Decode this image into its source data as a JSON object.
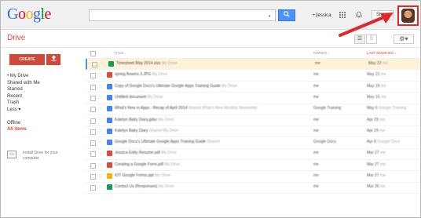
{
  "header": {
    "logo": [
      "G",
      "o",
      "o",
      "g",
      "l",
      "e"
    ],
    "search_placeholder": "",
    "search_dropdown": "▾",
    "search_icon": "search-icon",
    "user_name": "+Jessica",
    "share_label": "Share"
  },
  "subbar": {
    "title": "Drive"
  },
  "sidebar": {
    "create_label": "CREATE",
    "items": [
      "• My Drive",
      "Shared with Me",
      "Starred",
      "Recent",
      "Trash",
      "Less ▾",
      "",
      "Offline",
      "All items"
    ],
    "install_text": "Install Drive for your computer"
  },
  "list": {
    "headers": {
      "title": "TITLE",
      "owner": "OWNER ↓",
      "modified": "LAST MODIFIED ↓"
    },
    "rows": [
      {
        "icon_color": "#0f9d58",
        "title": "Timesheet May 2014.xlsx",
        "extra": "My Drive",
        "owner": "me",
        "modified": "May 22",
        "mod_extra": "me",
        "selected": true
      },
      {
        "icon_color": "#dd4b39",
        "title": "spring flowers 3.JPG",
        "extra": "My Drive",
        "owner": "me",
        "modified": "May 21",
        "mod_extra": "me"
      },
      {
        "icon_color": "#4285f4",
        "title": "Copy of Google Docs's Ultimate Google Apps Training Guide",
        "extra": "My Drive",
        "owner": "me",
        "modified": "May 19",
        "mod_extra": "me"
      },
      {
        "icon_color": "#4285f4",
        "title": "Untitled document",
        "extra": "My Drive",
        "owner": "me",
        "modified": "May 15",
        "mod_extra": "me"
      },
      {
        "icon_color": "#4285f4",
        "title": "What's New in Apps - Recap of April 2014",
        "extra": "Shared  What's New Monthly Newsletter",
        "owner": "Google Training",
        "modified": "May 6",
        "mod_extra": "Google Training"
      },
      {
        "icon_color": "#4285f4",
        "title": "Katelyn Baby Diary.gdoc",
        "extra": "My Drive",
        "owner": "me",
        "modified": "Apr 29",
        "mod_extra": "me"
      },
      {
        "icon_color": "#4285f4",
        "title": "Katelyn Baby Diary",
        "extra": "Shared  My Drive",
        "owner": "me",
        "modified": "Apr 29",
        "mod_extra": "me"
      },
      {
        "icon_color": "#4285f4",
        "title": "Google Docs's Ultimate Google Apps Training Guide",
        "extra": "Shared",
        "owner": "Google Docs",
        "modified": "Apr 8",
        "mod_extra": "Google Docs"
      },
      {
        "icon_color": "#dd4b39",
        "title": "Jessica Eddy Resume.pdf",
        "extra": "My Drive",
        "owner": "me",
        "modified": "Mar 27",
        "mod_extra": "me"
      },
      {
        "icon_color": "#dd4b39",
        "title": "Creating a Google Form.pdf",
        "extra": "My Drive",
        "owner": "me",
        "modified": "Mar 27",
        "mod_extra": "me"
      },
      {
        "icon_color": "#f4b400",
        "title": "IOT Google Forms.ppt",
        "extra": "My Drive",
        "owner": "me",
        "modified": "Mar 27",
        "mod_extra": "me"
      },
      {
        "icon_color": "#0f9d58",
        "title": "Contact Us (Responses)",
        "extra": "My Drive",
        "owner": "me",
        "modified": "Mar 26",
        "mod_extra": "me"
      }
    ]
  },
  "annotation": {
    "arrow_color": "#e3262b"
  }
}
